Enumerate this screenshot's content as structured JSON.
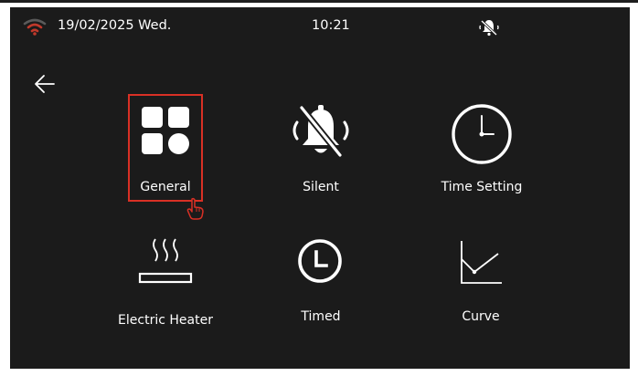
{
  "status_bar": {
    "date": "19/02/2025 Wed.",
    "time": "10:21",
    "icons": [
      "wifi-icon",
      "bell-muted-icon"
    ]
  },
  "navigation": {
    "back_icon": "arrow-left-icon"
  },
  "menu": {
    "selected": "General",
    "items": [
      {
        "label": "General",
        "icon": "general-grid-icon"
      },
      {
        "label": "Silent",
        "icon": "bell-muted-icon"
      },
      {
        "label": "Time Setting",
        "icon": "clock-icon"
      },
      {
        "label": "Electric Heater",
        "icon": "heater-icon"
      },
      {
        "label": "Timed",
        "icon": "timer-icon"
      },
      {
        "label": "Curve",
        "icon": "curve-chart-icon"
      }
    ]
  },
  "colors": {
    "screen_background": "#1b1b1b",
    "text": "#ffffff",
    "selection_outline": "#d93025",
    "wifi_accent": "#c0392b"
  }
}
